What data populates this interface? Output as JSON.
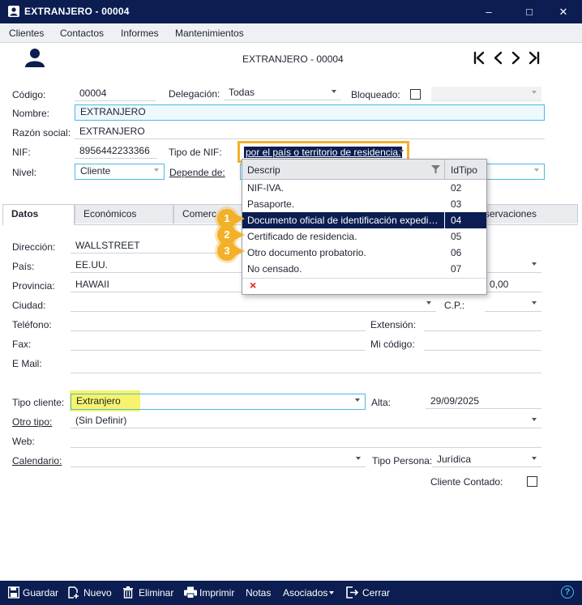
{
  "window": {
    "title": "EXTRANJERO - 00004",
    "minimize": "–",
    "maximize": "□",
    "close": "✕"
  },
  "menu": [
    "Clientes",
    "Contactos",
    "Informes",
    "Mantenimientos"
  ],
  "header": {
    "record_title": "EXTRANJERO - 00004"
  },
  "nav": {
    "first": "|<",
    "prev": "<",
    "next": ">",
    "last": ">|"
  },
  "form": {
    "codigo_label": "Código:",
    "codigo": "00004",
    "delegacion_label": "Delegación:",
    "delegacion": "Todas",
    "bloqueado_label": "Bloqueado:",
    "nombre_label": "Nombre:",
    "nombre": "EXTRANJERO",
    "razon_label": "Razón social:",
    "razon": "EXTRANJERO",
    "nif_label": "NIF:",
    "nif": "8956442233366",
    "tipo_nif_label": "Tipo de NIF:",
    "tipo_nif": "por el país o territorio de residencia.",
    "nivel_label": "Nivel:",
    "nivel": "Cliente",
    "depende_label": "Depende de:"
  },
  "tabs": [
    "Datos",
    "Económicos",
    "Comerc",
    "servaciones"
  ],
  "dropdown": {
    "col1": "Descrip",
    "col2": "IdTipo",
    "rows": [
      {
        "descrip": "NIF-IVA.",
        "id": "02"
      },
      {
        "descrip": "Pasaporte.",
        "id": "03"
      },
      {
        "descrip": "Documento oficial de identificación expedid...",
        "id": "04"
      },
      {
        "descrip": "Certificado de residencia.",
        "id": "05"
      },
      {
        "descrip": "Otro documento probatorio.",
        "id": "06"
      },
      {
        "descrip": "No censado.",
        "id": "07"
      }
    ],
    "clear": "×"
  },
  "badges": [
    "1",
    "2",
    "3"
  ],
  "datos": {
    "direccion_label": "Dirección:",
    "direccion": "WALLSTREET",
    "pais_label": "País:",
    "pais": "EE.UU.",
    "provincia_label": "Provincia:",
    "provincia": "HAWAII",
    "ciudad_label": "Ciudad:",
    "cp_label": "C.P.:",
    "right_value": "0,00",
    "telefono_label": "Teléfono:",
    "extension_label": "Extensión:",
    "fax_label": "Fax:",
    "micodigo_label": "Mi código:",
    "email_label": "E Mail:",
    "tipo_cliente_label": "Tipo cliente:",
    "tipo_cliente": "Extranjero",
    "alta_label": "Alta:",
    "alta": "29/09/2025",
    "otro_tipo_label": "Otro tipo:",
    "otro_tipo": "(Sin Definir)",
    "web_label": "Web:",
    "calendario_label": "Calendario:",
    "tipo_persona_label": "Tipo Persona:",
    "tipo_persona": "Jurídica",
    "cliente_contado_label": "Cliente Contado:"
  },
  "toolbar": {
    "guardar": "Guardar",
    "nuevo": "Nuevo",
    "eliminar": "Eliminar",
    "imprimir": "Imprimir",
    "notas": "Notas",
    "asociados": "Asociados",
    "cerrar": "Cerrar",
    "help": "?"
  },
  "colors": {
    "navy": "#0b1d51",
    "accent_blue": "#4cb8e6",
    "badge_orange": "#f3b12a",
    "highlight_yellow": "#f7f36a"
  }
}
